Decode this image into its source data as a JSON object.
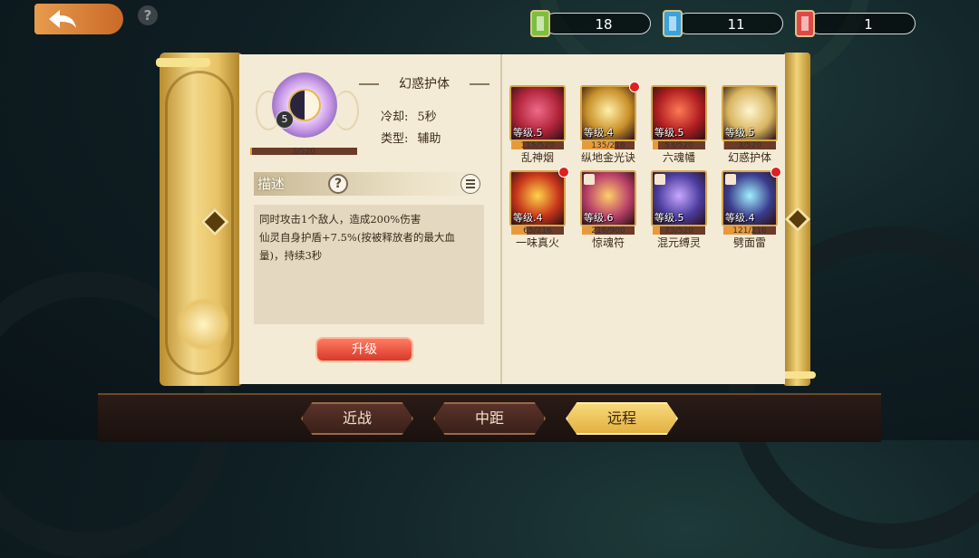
{
  "top": {
    "currencies": [
      {
        "value": "18",
        "color": "#7bbf3b"
      },
      {
        "value": "11",
        "color": "#3aa3d9"
      },
      {
        "value": "1",
        "color": "#e04848"
      }
    ]
  },
  "selected_skill": {
    "name": "幻惑护体",
    "level": "5",
    "progress_text": "3/520",
    "progress_fraction": 0.006,
    "cooldown_label": "冷却:",
    "cooldown_value": "5秒",
    "type_label": "类型:",
    "type_value": "辅助",
    "desc_title": "描述",
    "desc_help_glyph": "?",
    "desc_lines": [
      "同时攻击1个敌人，造成200%伤害",
      "仙灵自身护盾+7.5%(按被释放者的最大血",
      "量)，持续3秒"
    ],
    "upgrade_label": "升级"
  },
  "skills": [
    {
      "name": "乱神烟",
      "level": "等级.5",
      "progress": "115/520",
      "fraction": 0.22,
      "dot": false,
      "bg": "#b0243a",
      "accent": "#f06a8a"
    },
    {
      "name": "纵地金光诀",
      "level": "等级.4",
      "progress": "135/216",
      "fraction": 0.62,
      "dot": true,
      "bg": "#c9902a",
      "accent": "#fff1a8"
    },
    {
      "name": "六魂幡",
      "level": "等级.5",
      "progress": "53/520",
      "fraction": 0.1,
      "dot": false,
      "bg": "#b01e20",
      "accent": "#ff7a55"
    },
    {
      "name": "幻惑护体",
      "level": "等级.5",
      "progress": "3/520",
      "fraction": 0.006,
      "dot": false,
      "bg": "#d8b660",
      "accent": "#fff6d0"
    },
    {
      "name": "一味真火",
      "level": "等级.4",
      "progress": "65/216",
      "fraction": 0.3,
      "dot": true,
      "bg": "#c8351a",
      "accent": "#ffd34a"
    },
    {
      "name": "惊魂符",
      "level": "等级.6",
      "progress": "216/900",
      "fraction": 0.24,
      "dot": false,
      "bg": "#b9406a",
      "accent": "#ffcf6a"
    },
    {
      "name": "混元缚灵",
      "level": "等级.5",
      "progress": "73/520",
      "fraction": 0.14,
      "dot": false,
      "bg": "#4a3c9e",
      "accent": "#c9a7ff"
    },
    {
      "name": "劈面雷",
      "level": "等级.4",
      "progress": "121/216",
      "fraction": 0.56,
      "dot": true,
      "bg": "#3b3c8c",
      "accent": "#9ff0ff"
    }
  ],
  "tabs": [
    {
      "label": "近战",
      "active": false
    },
    {
      "label": "中距",
      "active": false
    },
    {
      "label": "远程",
      "active": true
    }
  ],
  "help_glyph": "?"
}
